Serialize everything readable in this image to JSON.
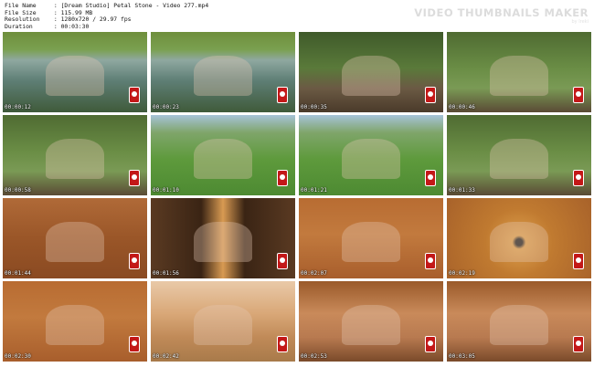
{
  "header": {
    "rows": [
      {
        "label": "File Name",
        "value": "[Dream Studio] Petal Stone - Video 277.mp4"
      },
      {
        "label": "File Size",
        "value": "115.99 MB"
      },
      {
        "label": "Resolution",
        "value": "1280x720 / 29.97 fps"
      },
      {
        "label": "Duration",
        "value": "00:03:30"
      }
    ],
    "brand": "VIDEO THUMBNAILS MAKER",
    "brand_sub": "by Ireki"
  },
  "thumbnails": [
    {
      "time": "00:00:12",
      "scene": "pond"
    },
    {
      "time": "00:00:23",
      "scene": "pond"
    },
    {
      "time": "00:00:35",
      "scene": "picnic"
    },
    {
      "time": "00:00:46",
      "scene": "bench"
    },
    {
      "time": "00:00:58",
      "scene": "bench"
    },
    {
      "time": "00:01:10",
      "scene": "pasture"
    },
    {
      "time": "00:01:21",
      "scene": "pasture"
    },
    {
      "time": "00:01:33",
      "scene": "bench"
    },
    {
      "time": "00:01:44",
      "scene": "wood"
    },
    {
      "time": "00:01:56",
      "scene": "door"
    },
    {
      "time": "00:02:07",
      "scene": "cabin"
    },
    {
      "time": "00:02:19",
      "scene": "roof"
    },
    {
      "time": "00:02:30",
      "scene": "cabin"
    },
    {
      "time": "00:02:42",
      "scene": "table"
    },
    {
      "time": "00:02:53",
      "scene": "portrait"
    },
    {
      "time": "00:03:05",
      "scene": "portrait"
    }
  ]
}
